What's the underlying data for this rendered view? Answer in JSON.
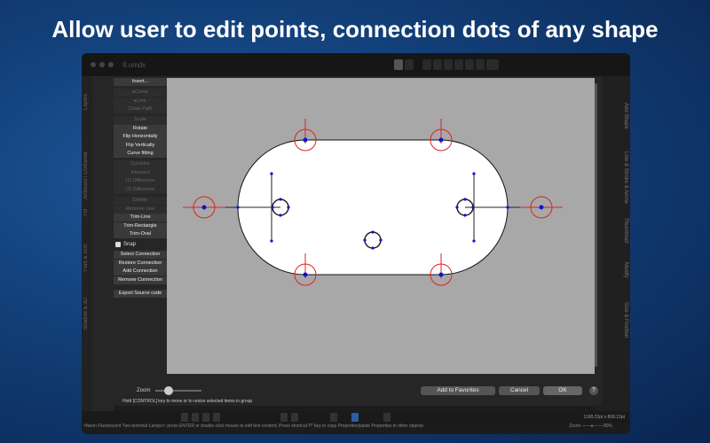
{
  "headline": "Allow user to edit points, connection dots of any shape",
  "window": {
    "title": "8.umdx"
  },
  "left_tabs": [
    "Layers",
    "Artboard / Container",
    "Fill",
    "Font & Text",
    "Shadow & 3D"
  ],
  "right_tabs": [
    "Add Shape",
    "Line & Stroke & Arrow",
    "Thumbnail",
    "Modify",
    "Size & Position"
  ],
  "menu": {
    "groups": [
      [
        {
          "label": "Insert...",
          "enabled": true
        }
      ],
      [
        {
          "label": "▸Curve",
          "enabled": false
        },
        {
          "label": "▸Line",
          "enabled": false
        },
        {
          "label": "Close Path",
          "enabled": false
        }
      ],
      [
        {
          "label": "Scale",
          "enabled": false
        },
        {
          "label": "Rotate",
          "enabled": true
        },
        {
          "label": "Flip Horizontally",
          "enabled": true
        },
        {
          "label": "Flip Vertically",
          "enabled": true
        },
        {
          "label": "Curve fitting",
          "enabled": true
        }
      ],
      [
        {
          "label": "Combine",
          "enabled": false
        },
        {
          "label": "Intersect",
          "enabled": false
        },
        {
          "label": "(1) Difference",
          "enabled": false
        },
        {
          "label": "(2) Difference",
          "enabled": false
        }
      ],
      [
        {
          "label": "Delete",
          "enabled": false
        },
        {
          "label": "Remove Line",
          "enabled": false
        },
        {
          "label": "Trim-Line",
          "enabled": true
        },
        {
          "label": "Trim-Rectangle",
          "enabled": true
        },
        {
          "label": "Trim-Oval",
          "enabled": true
        }
      ]
    ],
    "snap": {
      "label": "Snap",
      "checked": true
    },
    "connection": [
      {
        "label": "Select Connection"
      },
      {
        "label": "Restore Connection"
      },
      {
        "label": "Add Connection"
      },
      {
        "label": "Remove Connection"
      }
    ],
    "export": "Export Source code"
  },
  "zoom_label": "Zoom",
  "zoom_value": 0.3,
  "hint": "Hold [CONTROL] key to move or to resize selected items in group",
  "buttons": {
    "favorites": "Add to Favorites",
    "cancel": "Cancel",
    "ok": "OK",
    "help": "?"
  },
  "status": "<Neon Fluorescent Two-terminal Lamps>: press ENTER or double-click mouse to edit text content; Press shortcut 'P' key to copy Properties/paste Properties to other objects",
  "dimensions": "1168.22pt x 808.13pt",
  "bottom_zoom": {
    "label": "Zoom",
    "value": "80%"
  },
  "colors": {
    "handle": "#e02020",
    "point": "#1010d0",
    "canvas": "#a8a8a8"
  }
}
